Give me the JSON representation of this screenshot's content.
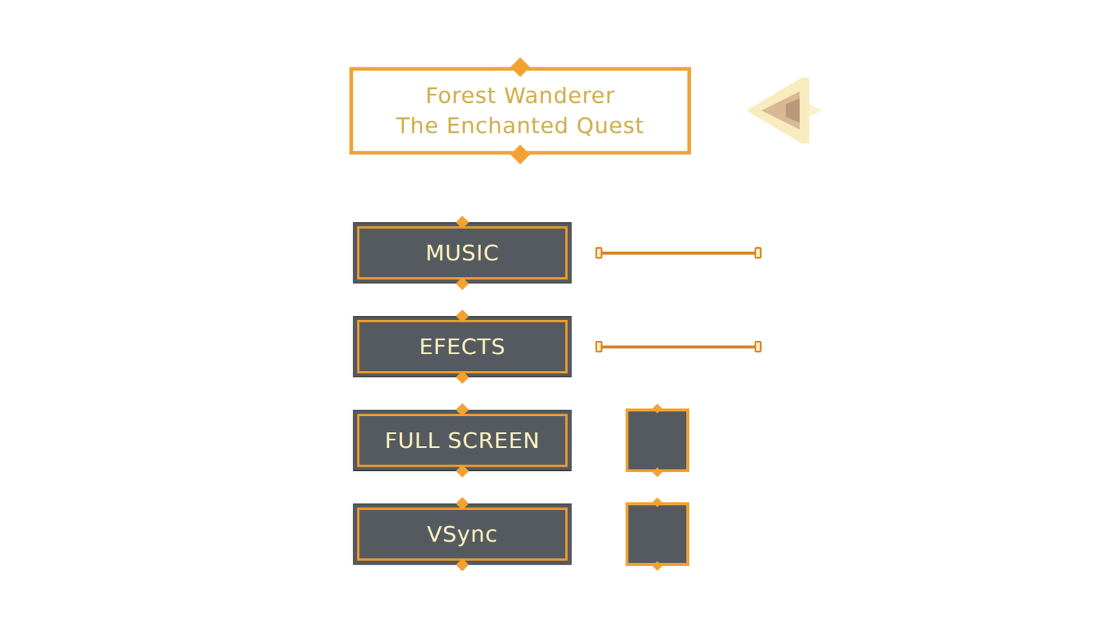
{
  "title": {
    "lines": [
      "Forest Wanderer",
      "The Enchanted Quest"
    ]
  },
  "settings": [
    {
      "label": "MUSIC",
      "kind": "slider",
      "level": 1.0
    },
    {
      "label": "EFECTS",
      "kind": "slider",
      "level": 1.0
    },
    {
      "label": "FULL SCREEN",
      "kind": "toggle",
      "checked": false
    },
    {
      "label": "VSync",
      "kind": "toggle",
      "checked": false
    }
  ]
}
